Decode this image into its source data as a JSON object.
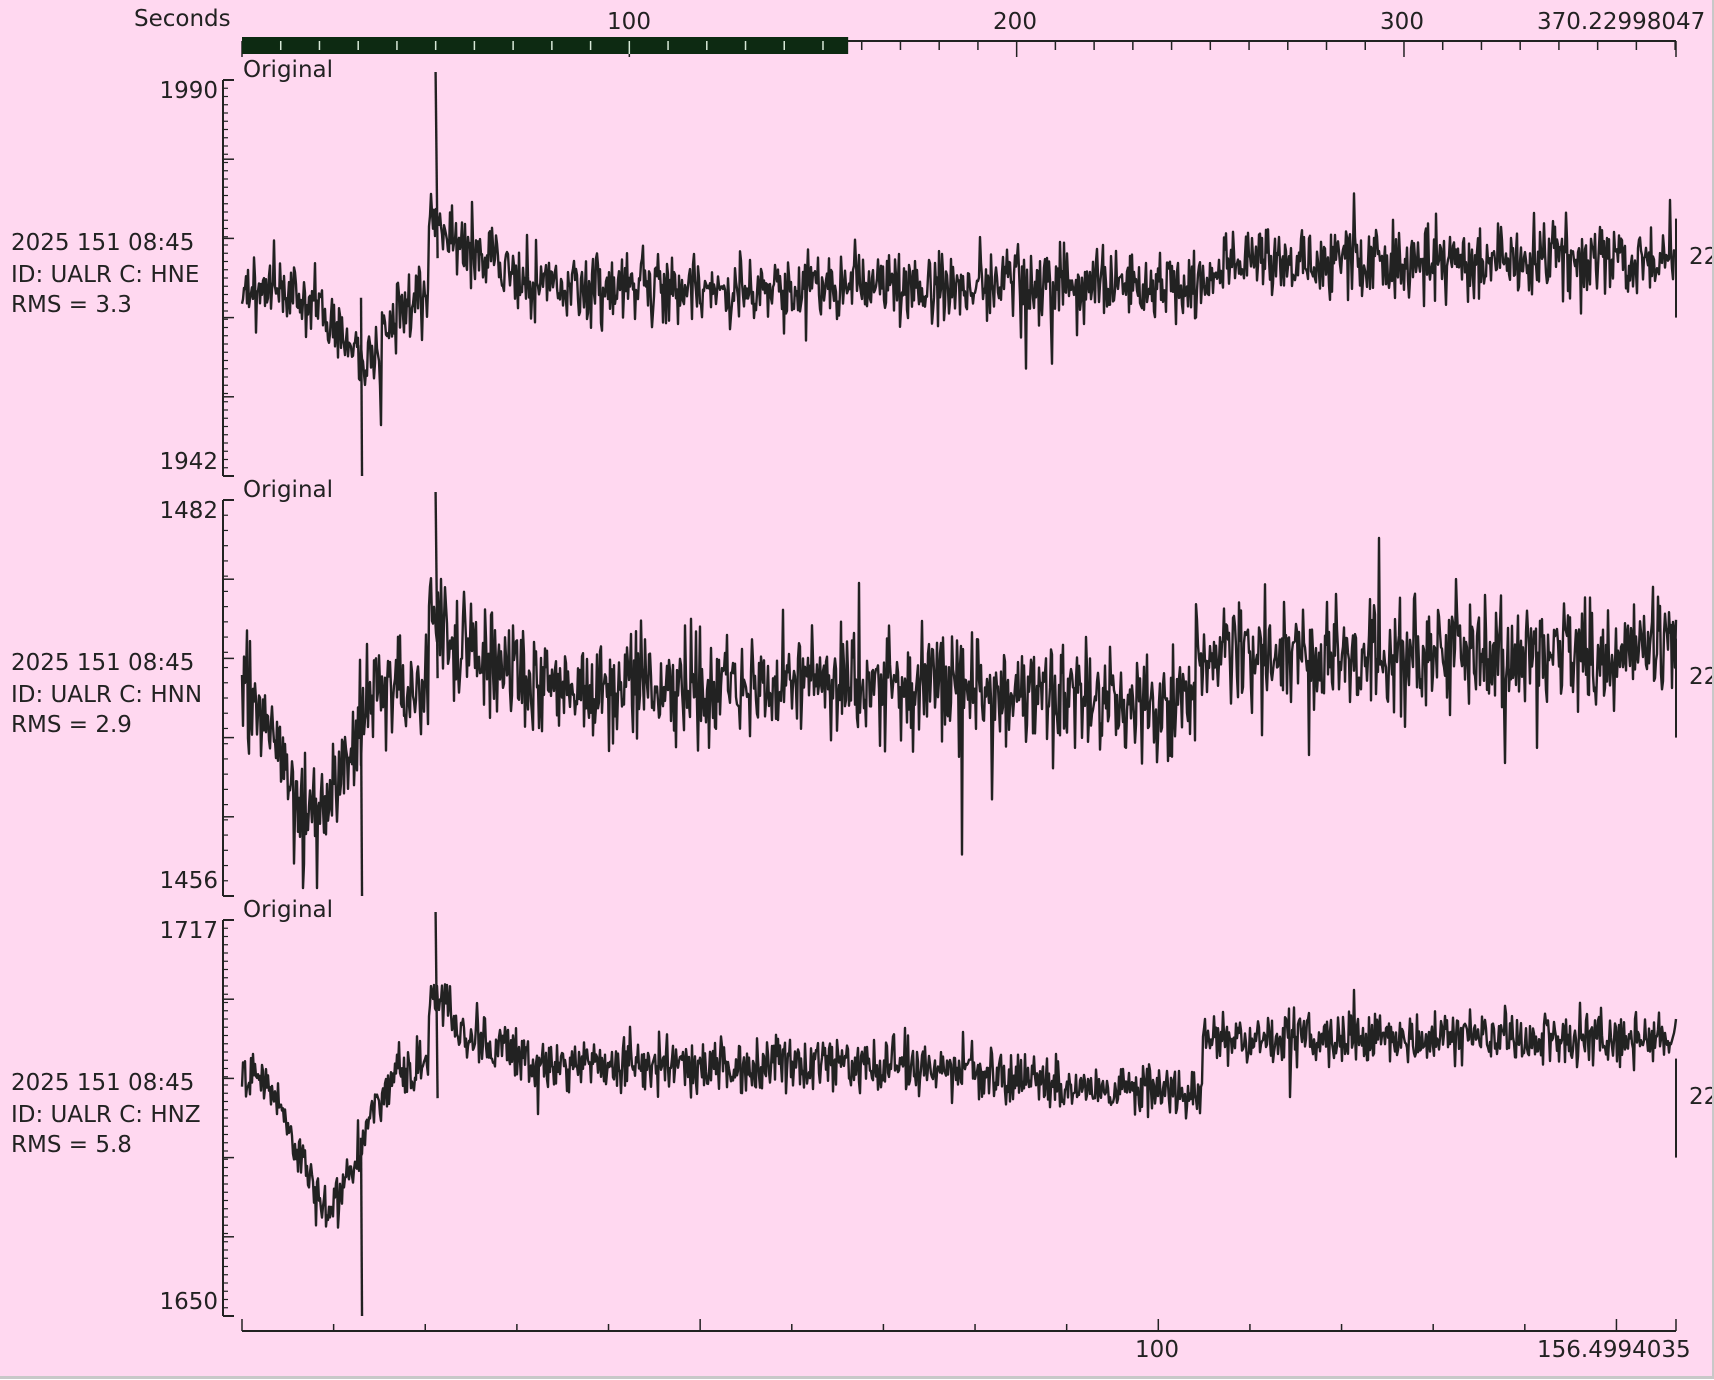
{
  "header": {
    "axis_label": "Seconds",
    "ticks": [
      "100",
      "200",
      "300"
    ],
    "end_value": "370.22998047",
    "selection_range_seconds": [
      0,
      156.4994
    ]
  },
  "bottom_axis": {
    "ticks": [
      "100"
    ],
    "end_value": "156.4994035"
  },
  "colors": {
    "background": "#ffd8f0",
    "trace": "#222222",
    "selection_bar": "#0d2a12"
  },
  "traces": [
    {
      "overlay": "Original",
      "datetime": "2025 151 08:45",
      "id_line": "ID: UALR C: HNE",
      "rms": "RMS = 3.3",
      "amp_max": "1990",
      "amp_min": "1942",
      "right_label": "22"
    },
    {
      "overlay": "Original",
      "datetime": "2025 151 08:45",
      "id_line": "ID: UALR C: HNN",
      "rms": "RMS = 2.9",
      "amp_max": "1482",
      "amp_min": "1456",
      "right_label": "22"
    },
    {
      "overlay": "Original",
      "datetime": "2025 151 08:45",
      "id_line": "ID: UALR C: HNZ",
      "rms": "RMS = 5.8",
      "amp_max": "1717",
      "amp_min": "1650",
      "right_label": "22"
    }
  ]
}
